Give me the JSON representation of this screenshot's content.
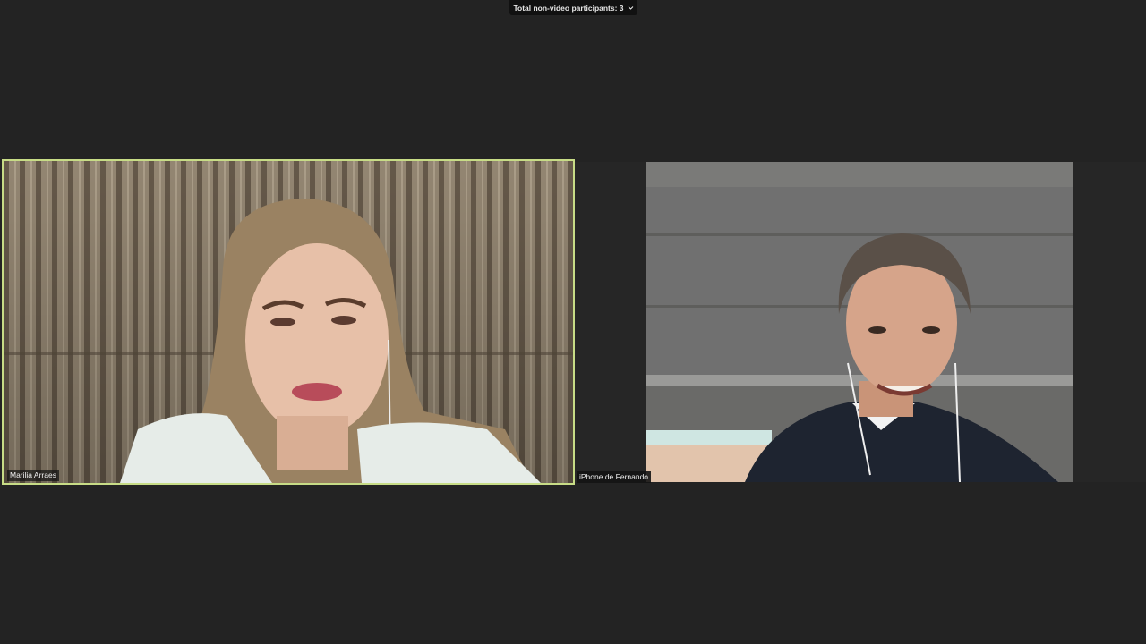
{
  "banner": {
    "label": "Total non-video participants: 3",
    "icon": "chevron-down-icon"
  },
  "participants": [
    {
      "name": "Marilia Arraes",
      "active_speaker": true
    },
    {
      "name": "iPhone de Fernando",
      "active_speaker": false
    }
  ],
  "colors": {
    "background": "#232323",
    "active_speaker_border": "#c7dc86"
  }
}
